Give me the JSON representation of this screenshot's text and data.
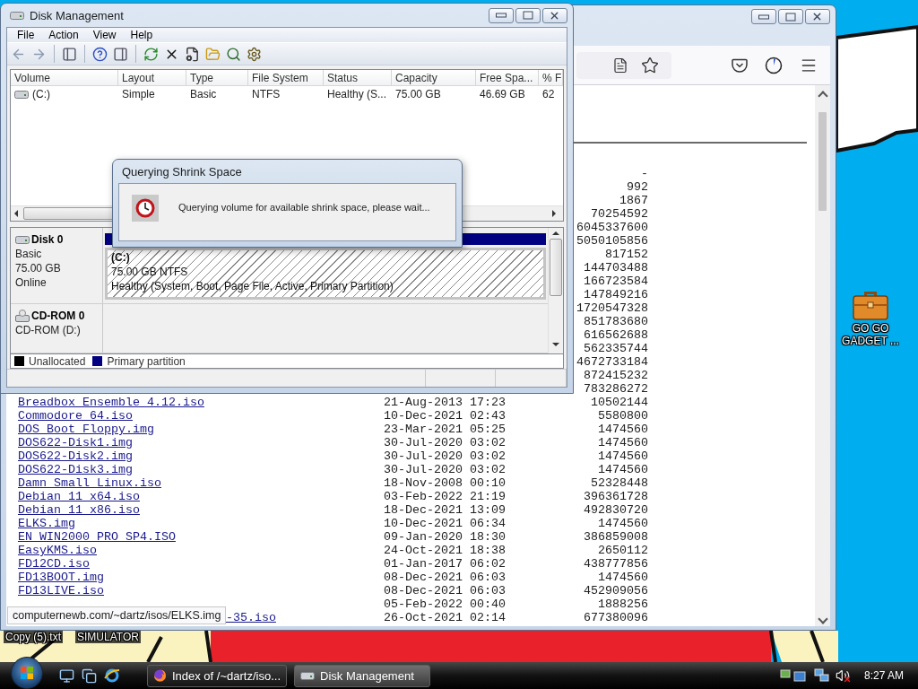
{
  "browser": {
    "listing": [
      {
        "size": "-"
      },
      {
        "size": "992"
      },
      {
        "size": "1867"
      },
      {
        "size": "70254592"
      },
      {
        "size": "6045337600"
      },
      {
        "size": "5050105856"
      },
      {
        "size": "817152"
      },
      {
        "size": "144703488"
      },
      {
        "size": "166723584"
      },
      {
        "size": "147849216"
      },
      {
        "size": "1720547328"
      },
      {
        "size": "851783680"
      },
      {
        "size": "616562688"
      },
      {
        "size": "562335744"
      },
      {
        "size": "4672733184"
      },
      {
        "size": "872415232"
      },
      {
        "size": "783286272"
      },
      {
        "name": "Breadbox_Ensemble_4.12.iso",
        "date": "21-Aug-2013 17:23",
        "size": "10502144"
      },
      {
        "name": "Commodore_64.iso",
        "date": "10-Dec-2021 02:43",
        "size": "5580800"
      },
      {
        "name": "DOS_Boot_Floppy.img",
        "date": "23-Mar-2021 05:25",
        "size": "1474560"
      },
      {
        "name": "DOS622-Disk1.img",
        "date": "30-Jul-2020 03:02",
        "size": "1474560"
      },
      {
        "name": "DOS622-Disk2.img",
        "date": "30-Jul-2020 03:02",
        "size": "1474560"
      },
      {
        "name": "DOS622-Disk3.img",
        "date": "30-Jul-2020 03:02",
        "size": "1474560"
      },
      {
        "name": "Damn_Small_Linux.iso",
        "date": "18-Nov-2008 00:10",
        "size": "52328448"
      },
      {
        "name": "Debian_11_x64.iso",
        "date": "03-Feb-2022 21:19",
        "size": "396361728"
      },
      {
        "name": "Debian_11_x86.iso",
        "date": "18-Dec-2021 13:09",
        "size": "492830720"
      },
      {
        "name": "ELKS.img",
        "date": "10-Dec-2021 06:34",
        "size": "1474560"
      },
      {
        "name": "EN_WIN2000_PRO_SP4.ISO",
        "date": "09-Jan-2020 18:30",
        "size": "386859008"
      },
      {
        "name": "EasyKMS.iso",
        "date": "24-Oct-2021 18:38",
        "size": "2650112"
      },
      {
        "name": "FD12CD.iso",
        "date": "01-Jan-2017 06:02",
        "size": "438777856"
      },
      {
        "name": "FD13BOOT.img",
        "date": "08-Dec-2021 06:03",
        "size": "1474560"
      },
      {
        "name": "FD13LIVE.iso",
        "date": "08-Dec-2021 06:03",
        "size": "452909056"
      },
      {
        "date": "05-Feb-2022 00:40",
        "size": "1888256"
      },
      {
        "name": "-35.iso",
        "clipped": true,
        "date": "26-Oct-2021 02:14",
        "size": "677380096"
      }
    ],
    "link_tooltip": "computernewb.com/~dartz/isos/ELKS.img"
  },
  "disk_management": {
    "title": "Disk Management",
    "menu": [
      "File",
      "Action",
      "View",
      "Help"
    ],
    "columns": [
      "Volume",
      "Layout",
      "Type",
      "File System",
      "Status",
      "Capacity",
      "Free Spa...",
      "% F"
    ],
    "volumes": [
      {
        "cells": [
          "(C:)",
          "Simple",
          "Basic",
          "NTFS",
          "Healthy (S...",
          "75.00 GB",
          "46.69 GB",
          "62"
        ]
      }
    ],
    "disks": [
      {
        "kind": "disk",
        "name": "Disk 0",
        "details": [
          "Basic",
          "75.00 GB",
          "Online"
        ],
        "partitions": [
          {
            "name": "(C:)",
            "size": "75.00 GB NTFS",
            "status": "Healthy (System, Boot, Page File, Active, Primary Partition)",
            "selected": true,
            "color": "#000080"
          }
        ]
      },
      {
        "kind": "cdrom",
        "name": "CD-ROM 0",
        "details": [
          "CD-ROM (D:)"
        ]
      }
    ],
    "legend": [
      {
        "label": "Unallocated",
        "color": "#000000"
      },
      {
        "label": "Primary partition",
        "color": "#000080"
      }
    ]
  },
  "dialog": {
    "title": "Querying Shrink Space",
    "message": "Querying volume for available shrink space, please wait..."
  },
  "desktop_icons": [
    {
      "label": "GO GO GADGET ..."
    },
    {
      "label": "Copy (5).txt"
    },
    {
      "label": "SIMULATOR"
    }
  ],
  "taskbar": {
    "buttons": [
      {
        "label": "Index of /~dartz/iso...",
        "selected": false
      },
      {
        "label": "Disk Management",
        "selected": true
      }
    ],
    "clock": "8:27 AM"
  }
}
